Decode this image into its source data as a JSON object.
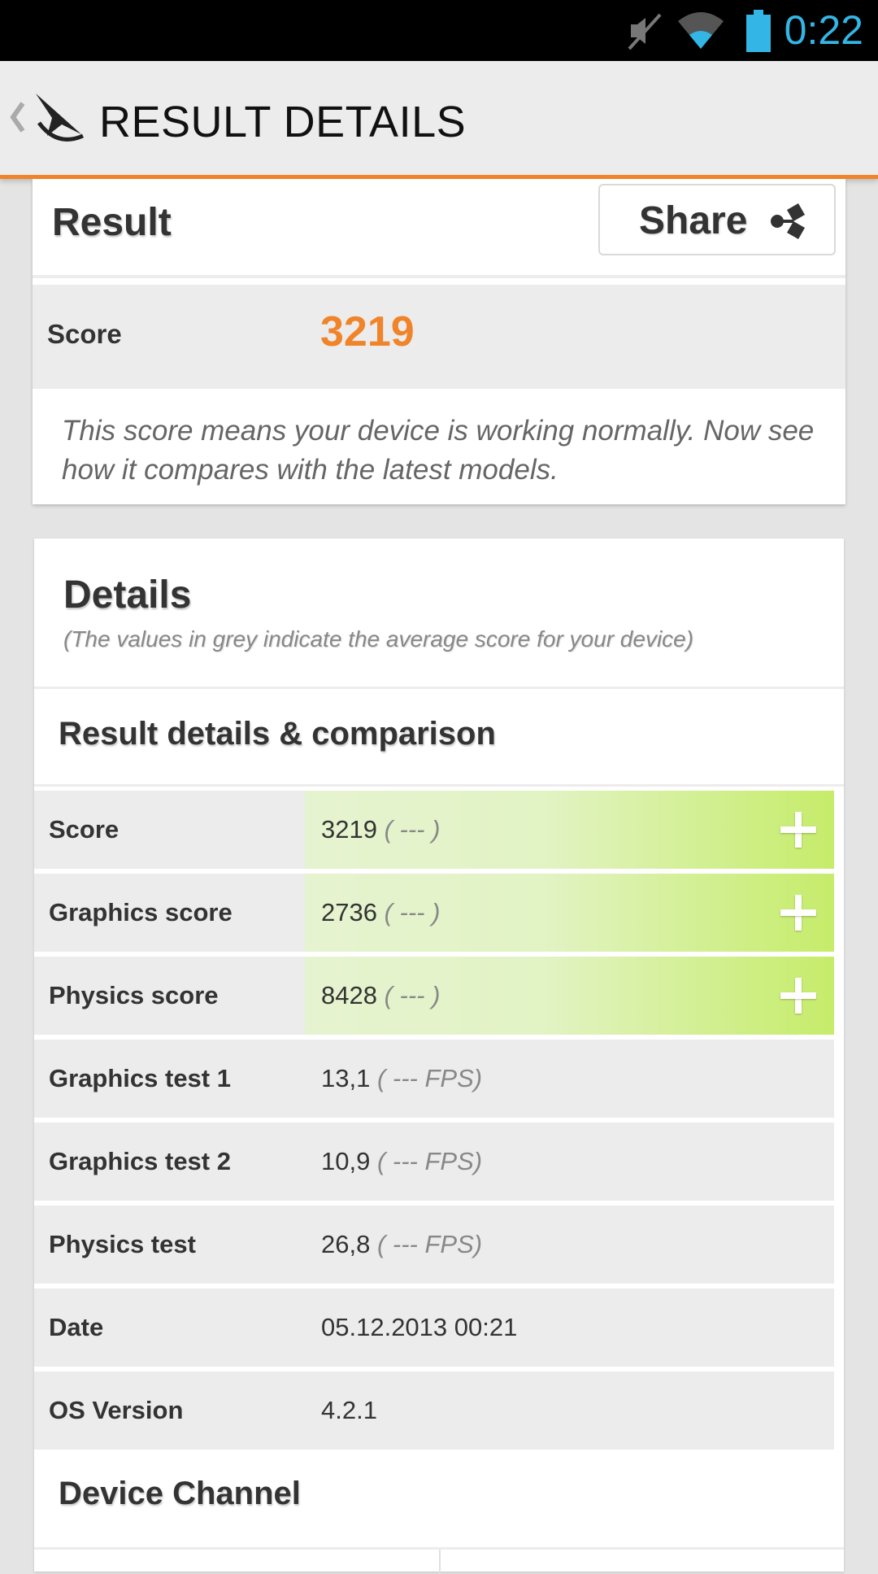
{
  "status_bar": {
    "time": "0:22",
    "icons": [
      "mute-icon",
      "wifi-icon",
      "battery-icon"
    ],
    "accent_color": "#33b5e5"
  },
  "action_bar": {
    "title": "RESULT DETAILS",
    "icons": [
      "back-chevron-icon",
      "app-logo-icon"
    ],
    "accent_color": "#f0842a"
  },
  "result": {
    "title": "Result",
    "share_label": "Share",
    "score_label": "Score",
    "score_value": "3219",
    "note": "This score means your device is working normally. Now see how it compares with the latest models."
  },
  "details": {
    "title": "Details",
    "subtitle": "(The values in grey indicate the average score for your device)",
    "section_title": "Result details & comparison",
    "rows": [
      {
        "label": "Score",
        "value": "3219",
        "avg": "( --- )",
        "expandable": true
      },
      {
        "label": "Graphics score",
        "value": "2736",
        "avg": "( --- )",
        "expandable": true
      },
      {
        "label": "Physics score",
        "value": "8428",
        "avg": "( --- )",
        "expandable": true
      },
      {
        "label": "Graphics test 1",
        "value": "13,1",
        "avg": "( --- FPS)",
        "expandable": false
      },
      {
        "label": "Graphics test 2",
        "value": "10,9",
        "avg": "( --- FPS)",
        "expandable": false
      },
      {
        "label": "Physics test",
        "value": "26,8",
        "avg": "( --- FPS)",
        "expandable": false
      },
      {
        "label": "Date",
        "value": "05.12.2013 00:21",
        "avg": "",
        "expandable": false
      },
      {
        "label": "OS Version",
        "value": "4.2.1",
        "avg": "",
        "expandable": false
      }
    ],
    "device_channel_title": "Device Channel"
  }
}
